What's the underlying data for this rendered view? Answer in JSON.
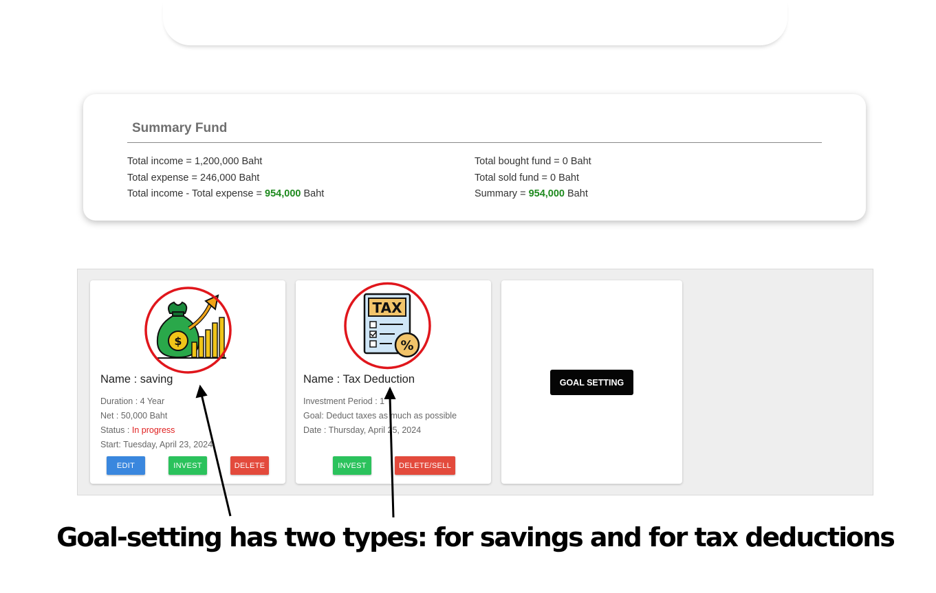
{
  "summary": {
    "title": "Summary Fund",
    "income_label": "Total income = ",
    "income_value": "1,200,000 Baht",
    "expense_label": "Total expense = ",
    "expense_value": "246,000 Baht",
    "net_label": "Total income - Total expense = ",
    "net_value": "954,000",
    "net_unit": " Baht",
    "bought_label": "Total bought fund = ",
    "bought_value": "0 Baht",
    "sold_label": "Total sold fund = ",
    "sold_value": "0 Baht",
    "summary_label": "Summary = ",
    "summary_value": "954,000",
    "summary_unit": " Baht",
    "highlight_color": "#1e8a1e"
  },
  "goals": [
    {
      "icon": "money-bag-growth-icon",
      "name": "Name : saving",
      "duration": "Duration : 4 Year",
      "net": "Net : 50,000 Baht",
      "status_label": "Status : ",
      "status_value": "In progress",
      "start": "Start: Tuesday, April 23, 2024",
      "buttons": [
        "EDIT",
        "INVEST",
        "DELETE"
      ]
    },
    {
      "icon": "tax-document-icon",
      "name": "Name : Tax Deduction",
      "period": "Investment Period : 1",
      "goal": "Goal: Deduct taxes as much as possible",
      "date": "Date : Thursday, April 25, 2024",
      "buttons": [
        "INVEST",
        "DELETE/SELL"
      ]
    }
  ],
  "goal_setting_label": "GOAL SETTING",
  "caption": "Goal-setting has two types: for savings and for tax deductions",
  "colors": {
    "edit": "#3a87de",
    "invest": "#2bc25c",
    "delete": "#e34a3c",
    "status_in_progress": "#e02020",
    "annotation_circle": "#e0161c"
  }
}
